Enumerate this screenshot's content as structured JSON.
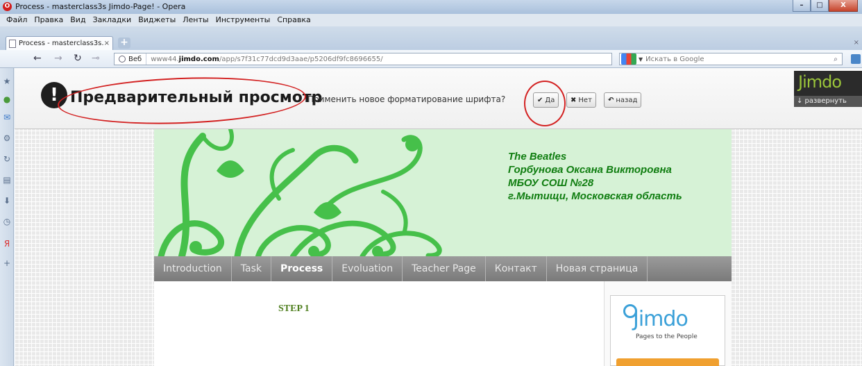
{
  "window": {
    "app_logo": "O",
    "title": "Process - masterclass3s Jimdo-Page! - Opera",
    "controls": {
      "minimize": "–",
      "maximize": "□",
      "close": "X"
    }
  },
  "menu": [
    "Файл",
    "Правка",
    "Вид",
    "Закладки",
    "Виджеты",
    "Ленты",
    "Инструменты",
    "Справка"
  ],
  "tab": {
    "label": "Process - masterclass3s...",
    "close": "×",
    "new_tab": "+",
    "close_all": "×"
  },
  "address": {
    "back": "←",
    "forward": "→",
    "reload": "↻",
    "key": "⊸",
    "site_label": "Веб",
    "url_prefix": "www44.",
    "url_domain": "jimdo.com",
    "url_path": "/app/s7f31c77dcd9d3aae/p5206df9fc8696655/",
    "search_placeholder": "Искать в Google",
    "search_icon": "⌕"
  },
  "sidebar": {
    "icons": [
      "star-icon",
      "extensions-icon",
      "mail-icon",
      "settings-icon",
      "share-icon",
      "notes-icon",
      "downloads-icon",
      "history-icon",
      "yandex-icon",
      "add-icon"
    ],
    "glyphs": [
      "★",
      "●",
      "✉",
      "⚙",
      "↻",
      "▤",
      "⬇",
      "◷",
      "Я",
      "+"
    ]
  },
  "preview": {
    "exclamation": "!",
    "title": "Предварительный просмотр",
    "prompt": "Применить новое форматирование шрифта?",
    "yes_icon": "✔",
    "yes": "Да",
    "no_icon": "✖",
    "no": "Нет",
    "back_icon": "↶",
    "back": "назад",
    "jimdo_logo": "Jimdo",
    "expand": "↓ развернуть"
  },
  "site": {
    "header_lines": [
      "The Beatles",
      "Горбунова Оксана Викторовна",
      "МБОУ СОШ №28",
      "г.Мытищи, Московская область"
    ],
    "nav": [
      {
        "label": "Introduction",
        "active": false
      },
      {
        "label": "Task",
        "active": false
      },
      {
        "label": "Process",
        "active": true
      },
      {
        "label": "Evoluation",
        "active": false
      },
      {
        "label": "Teacher Page",
        "active": false
      },
      {
        "label": "Контакт",
        "active": false
      },
      {
        "label": "Новая страница",
        "active": false
      }
    ],
    "step_heading": "STEP 1",
    "badge_logo": "Jimdo",
    "badge_tagline": "Pages to the People"
  },
  "colors": {
    "accent_green": "#0f7d10",
    "annotation_red": "#d32222",
    "header_bg": "#d6f2d6"
  }
}
